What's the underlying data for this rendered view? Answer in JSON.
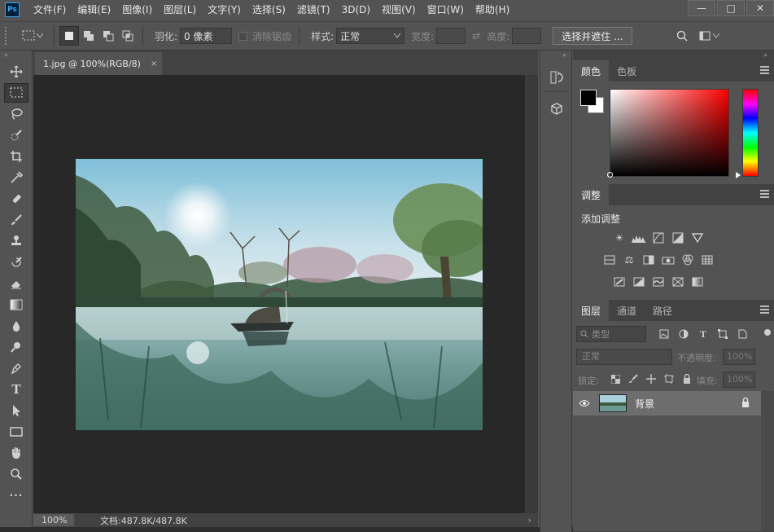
{
  "app": {
    "logo": "Ps"
  },
  "menu": [
    "文件(F)",
    "编辑(E)",
    "图像(I)",
    "图层(L)",
    "文字(Y)",
    "选择(S)",
    "滤镜(T)",
    "3D(D)",
    "视图(V)",
    "窗口(W)",
    "帮助(H)"
  ],
  "window_controls": {
    "minimize": "—",
    "restore": "□",
    "close": "✕"
  },
  "options": {
    "feather_label": "羽化:",
    "feather_value": "0 像素",
    "antialias_label": "消除锯齿",
    "style_label": "样式:",
    "style_value": "正常",
    "width_label": "宽度:",
    "height_label": "高度:",
    "mask_button": "选择并遮住 ..."
  },
  "document": {
    "tab_title": "1.jpg @ 100%(RGB/8)",
    "close": "×",
    "zoom": "100%",
    "doc_info": "文档:487.8K/487.8K"
  },
  "color_panel": {
    "tabs": [
      "颜色",
      "色板"
    ],
    "foreground": "#000000",
    "background": "#ffffff"
  },
  "adjust_panel": {
    "tab": "调整",
    "title": "添加调整"
  },
  "layers_panel": {
    "tabs": [
      "图层",
      "通道",
      "路径"
    ],
    "filter_placeholder": "类型",
    "blend_mode": "正常",
    "opacity_label": "不透明度:",
    "opacity_value": "100%",
    "lock_label": "锁定:",
    "fill_label": "填充:",
    "fill_value": "100%",
    "layers": [
      {
        "name": "背景",
        "visible": true,
        "locked": true
      }
    ]
  },
  "colors": {
    "ui_bg": "#535353",
    "canvas_bg": "#282828",
    "accent": "#31a8ff"
  }
}
